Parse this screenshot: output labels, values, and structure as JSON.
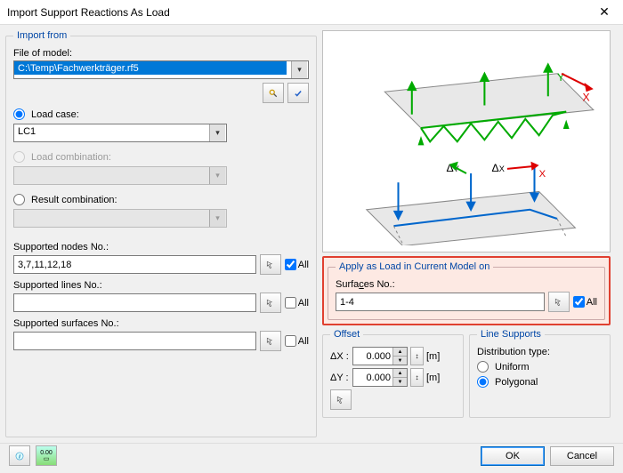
{
  "window": {
    "title": "Import Support Reactions As Load"
  },
  "importFrom": {
    "legend": "Import from",
    "fileLabel": "File of model:",
    "fileValue": "C:\\Temp\\Fachwerkträger.rf5",
    "loadCaseLabel": "Load case:",
    "loadCaseValue": "LC1",
    "loadComboLabel": "Load combination:",
    "loadComboValue": "",
    "resultComboLabel": "Result combination:",
    "resultComboValue": "",
    "nodesLabel": "Supported nodes No.:",
    "nodesValue": "3,7,11,12,18",
    "linesLabel": "Supported lines No.:",
    "linesValue": "",
    "surfLabel": "Supported surfaces No.:",
    "surfValue": "",
    "allLabel": "All"
  },
  "apply": {
    "legend": "Apply as Load in Current Model on",
    "surfLabel": "Surfaces No.:",
    "surfValue": "1-4",
    "allLabel": "All"
  },
  "offset": {
    "legend": "Offset",
    "dxLabel": "ΔX :",
    "dyLabel": "ΔY :",
    "dxValue": "0.000",
    "dyValue": "0.000",
    "unit": "[m]"
  },
  "lineSupports": {
    "legend": "Line Supports",
    "distLabel": "Distribution type:",
    "uniformLabel": "Uniform",
    "polygonalLabel": "Polygonal"
  },
  "buttons": {
    "ok": "OK",
    "cancel": "Cancel"
  }
}
